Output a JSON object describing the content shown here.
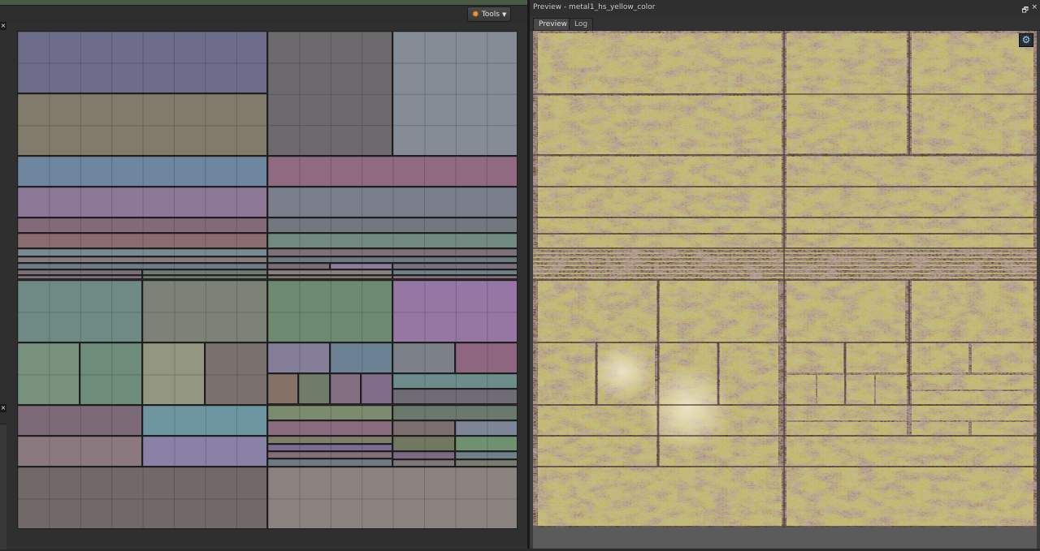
{
  "toolbar": {
    "tools_label": "Tools"
  },
  "close_glyph": "×",
  "preview": {
    "title": "Preview - metal1_hs_yellow_color",
    "tabs": [
      "Preview",
      "Log"
    ],
    "active_tab": "Preview",
    "restore_glyph": "🗗",
    "close_glyph": "×",
    "settings_glyph": "⚙"
  },
  "icons": {
    "tools": "gear-icon",
    "dropdown": "caret-down-icon",
    "restore": "restore-window-icon",
    "close": "close-icon",
    "settings": "gear-icon"
  },
  "colors": {
    "accent_orange": "#f2902c",
    "panel_dark": "#2f2f2f",
    "paint_yellow": "#c7b64a",
    "rust": "#7a4530"
  }
}
